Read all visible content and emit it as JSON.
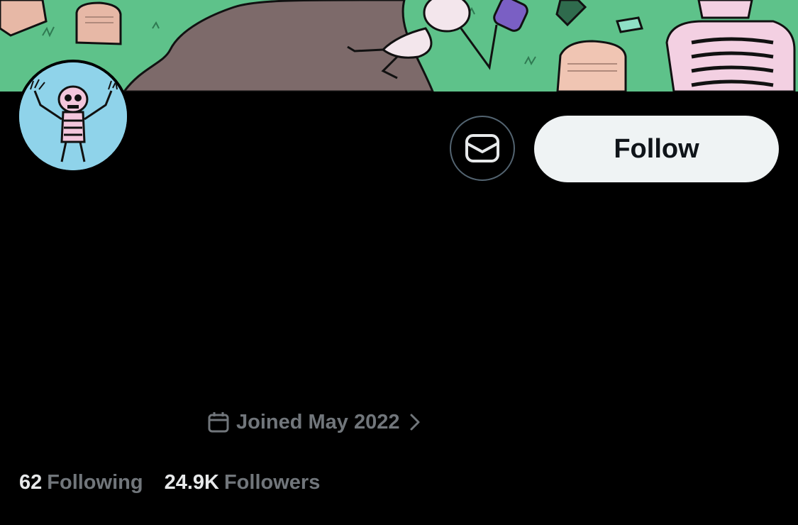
{
  "profile": {
    "follow_label": "Follow",
    "joined_text": "Joined May 2022",
    "following_count": "62",
    "following_label": "Following",
    "followers_count": "24.9K",
    "followers_label": "Followers"
  },
  "icons": {
    "message": "envelope-icon",
    "calendar": "calendar-icon",
    "chevron": "chevron-right-icon"
  },
  "colors": {
    "background": "#000000",
    "follow_button_bg": "#eff3f4",
    "follow_button_text": "#0f1419",
    "muted_text": "#71767b",
    "primary_text": "#e7e9ea",
    "avatar_bg": "#8fd3ea",
    "banner_grass": "#5ec28a",
    "banner_path": "#7d6a6a"
  }
}
